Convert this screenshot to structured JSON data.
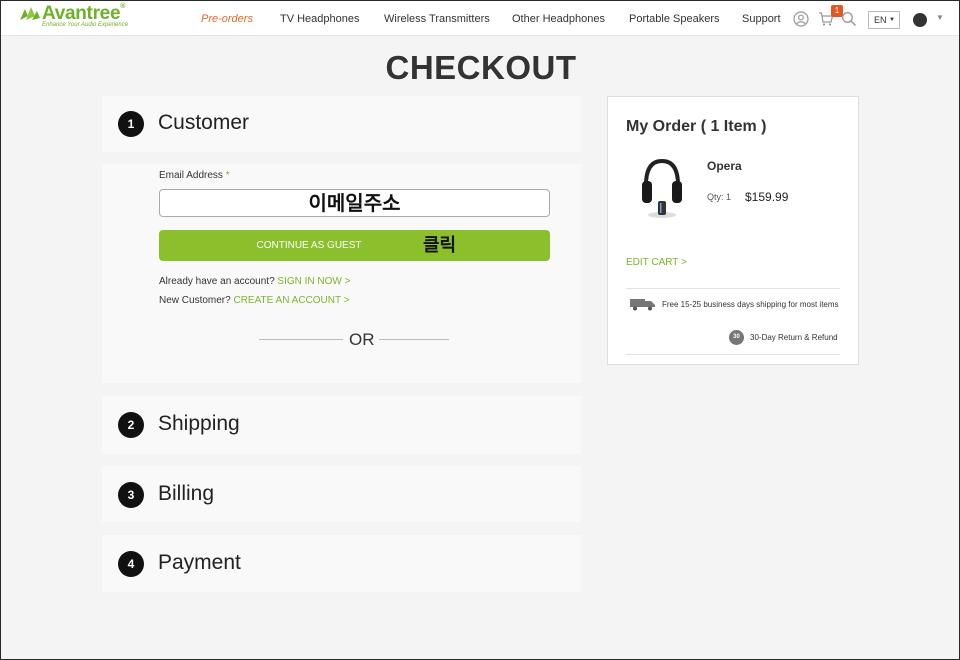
{
  "brand": {
    "name": "Avantree",
    "reg": "®",
    "tagline": "Enhance Your Audio Experience",
    "color": "#6fb02a"
  },
  "nav": {
    "items": [
      {
        "label": "Pre-orders",
        "active": true
      },
      {
        "label": "TV Headphones"
      },
      {
        "label": "Wireless Transmitters"
      },
      {
        "label": "Other Headphones"
      },
      {
        "label": "Portable Speakers"
      },
      {
        "label": "Support"
      }
    ],
    "cart_count": "1",
    "language": "EN",
    "icons": [
      "user-icon",
      "cart-icon",
      "search-icon",
      "globe-icon"
    ]
  },
  "page": {
    "title": "CHECKOUT"
  },
  "steps": [
    {
      "number": "1",
      "title": "Customer"
    },
    {
      "number": "2",
      "title": "Shipping"
    },
    {
      "number": "3",
      "title": "Billing"
    },
    {
      "number": "4",
      "title": "Payment"
    }
  ],
  "customer": {
    "email_label": "Email Address",
    "required_mark": "*",
    "email_value": "이메일주소",
    "guest_button": "CONTINUE AS GUEST",
    "guest_annotation": "클릭",
    "signin_prompt": "Already have an account?",
    "signin_link": "SIGN IN NOW >",
    "create_prompt": "New Customer?",
    "create_link": "CREATE AN ACCOUNT >",
    "or_text": "OR"
  },
  "order": {
    "title": "My Order ( 1 Item )",
    "product_name": "Opera",
    "qty": "Qty: 1",
    "price": "$159.99",
    "edit_cart": "EDIT CART >",
    "shipping_note": "Free 15-25 business days shipping for most items",
    "return_badge": "30",
    "return_note": "30-Day Return & Refund"
  },
  "colors": {
    "accent_green": "#8cbf2c",
    "link_green": "#7bb52b",
    "active_nav": "#e06b2a",
    "badge": "#e25822"
  }
}
